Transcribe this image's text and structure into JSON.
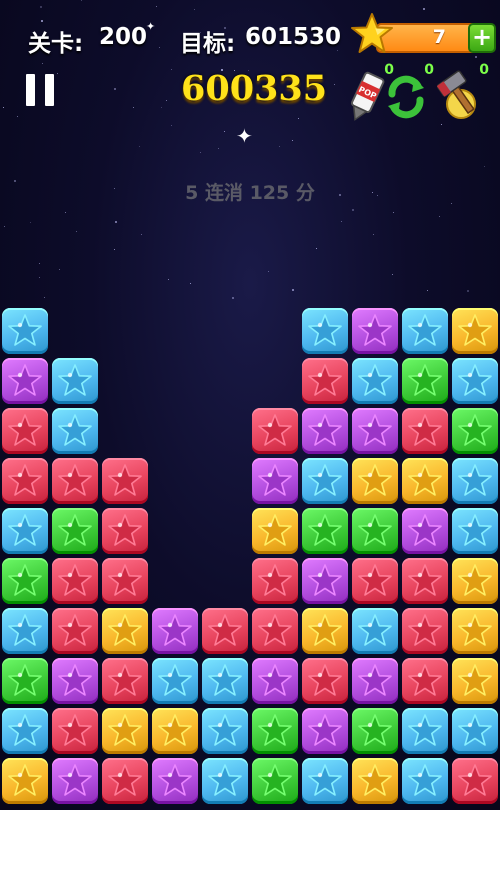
{
  "hud": {
    "level_label": "关卡:",
    "level_value": "200",
    "target_label": "目标:",
    "target_value": "601530",
    "coins": "7",
    "plus": "+"
  },
  "score": "600335",
  "tools": {
    "pop_count": "0",
    "refresh_count": "0",
    "hammer_count": "0",
    "pop_label": "POP"
  },
  "combo_text": "5 连消 125 分",
  "colors": {
    "B": "#4fb8f0",
    "P": "#b44fe0",
    "R": "#e8445e",
    "G": "#3fcc3a",
    "Y": "#f9b72c"
  },
  "board": {
    "cols": 10,
    "rows": 10,
    "grid": [
      "B.....BPBY",
      "PB....RBGB",
      "RB...RPPRG",
      "RRR..PBYYB",
      "BGR..YGGPB",
      "GRR..RPRRY",
      "BRYPRRYBRY",
      "GPRBBPRPRY",
      "BRYYBGPGBB",
      "YPRPBGBYBR"
    ]
  }
}
